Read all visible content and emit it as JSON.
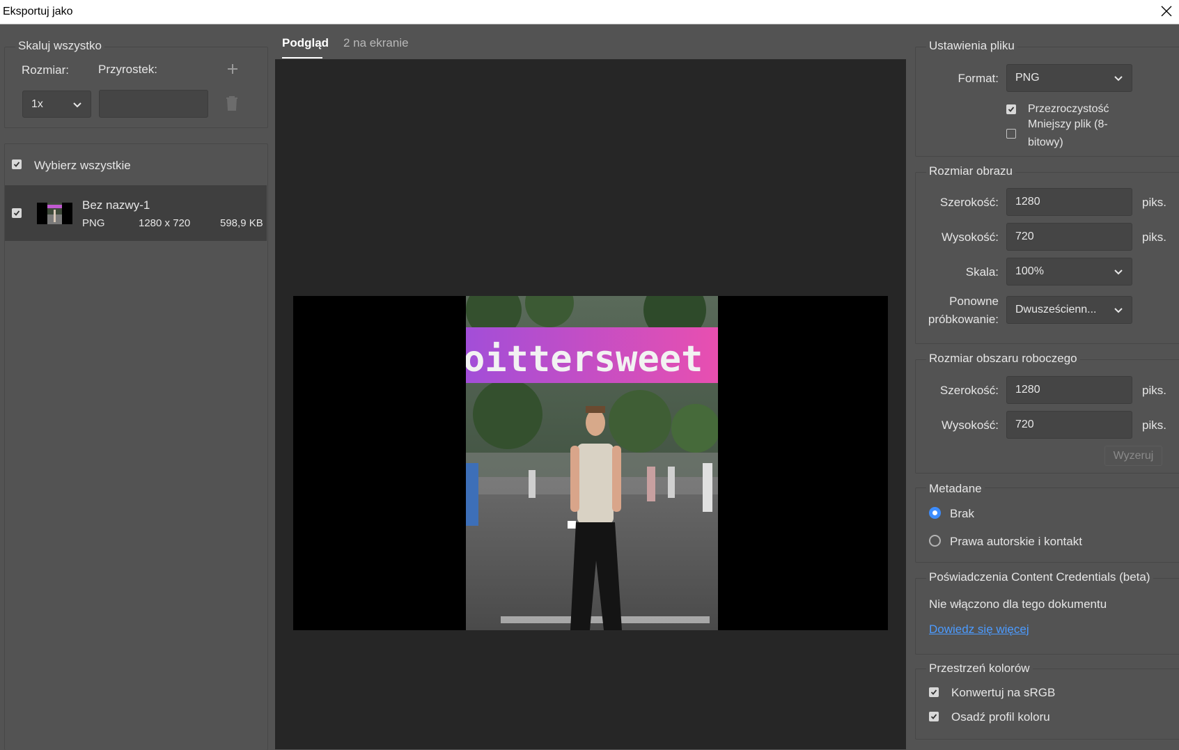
{
  "window": {
    "title": "Eksportuj jako"
  },
  "scale_panel": {
    "title": "Skaluj wszystko",
    "size_label": "Rozmiar:",
    "suffix_label": "Przyrostek:",
    "size_value": "1x",
    "suffix_value": ""
  },
  "assets": {
    "select_all_label": "Wybierz wszystkie",
    "select_all_checked": true,
    "items": [
      {
        "name": "Bez nazwy-1",
        "format": "PNG",
        "dimensions": "1280 x 720",
        "size": "598,9 KB",
        "checked": true
      }
    ]
  },
  "tabs": [
    {
      "label": "Podgląd",
      "active": true
    },
    {
      "label": "2 na ekranie",
      "active": false
    }
  ],
  "preview": {
    "banner_text": "oittersweet"
  },
  "file_settings": {
    "title": "Ustawienia pliku",
    "format_label": "Format:",
    "format_value": "PNG",
    "transparency_label": "Przezroczystość",
    "transparency_checked": true,
    "smaller_file_label_1": "Mniejszy plik (8-",
    "smaller_file_label_2": "bitowy)",
    "smaller_file_checked": false
  },
  "image_size": {
    "title": "Rozmiar obrazu",
    "width_label": "Szerokość:",
    "width_value": "1280",
    "height_label": "Wysokość:",
    "height_value": "720",
    "unit": "piks.",
    "scale_label": "Skala:",
    "scale_value": "100%",
    "resample_label_1": "Ponowne",
    "resample_label_2": "próbkowanie:",
    "resample_value": "Dwusześcienn..."
  },
  "canvas_size": {
    "title": "Rozmiar obszaru roboczego",
    "width_label": "Szerokość:",
    "width_value": "1280",
    "height_label": "Wysokość:",
    "height_value": "720",
    "unit": "piks.",
    "reset_label": "Wyzeruj"
  },
  "metadata": {
    "title": "Metadane",
    "options": [
      "Brak",
      "Prawa autorskie i kontakt"
    ],
    "selected": "Brak"
  },
  "content_credentials": {
    "title": "Poświadczenia Content Credentials (beta)",
    "status": "Nie włączono dla tego dokumentu",
    "link": "Dowiedz się więcej"
  },
  "color_space": {
    "title": "Przestrzeń kolorów",
    "convert_label": "Konwertuj na sRGB",
    "convert_checked": true,
    "embed_label": "Osadź profil koloru",
    "embed_checked": true
  },
  "colors": {
    "accent": "#3d8dff",
    "link": "#4c9bff",
    "background": "#535353",
    "preview_bg": "#262626"
  }
}
